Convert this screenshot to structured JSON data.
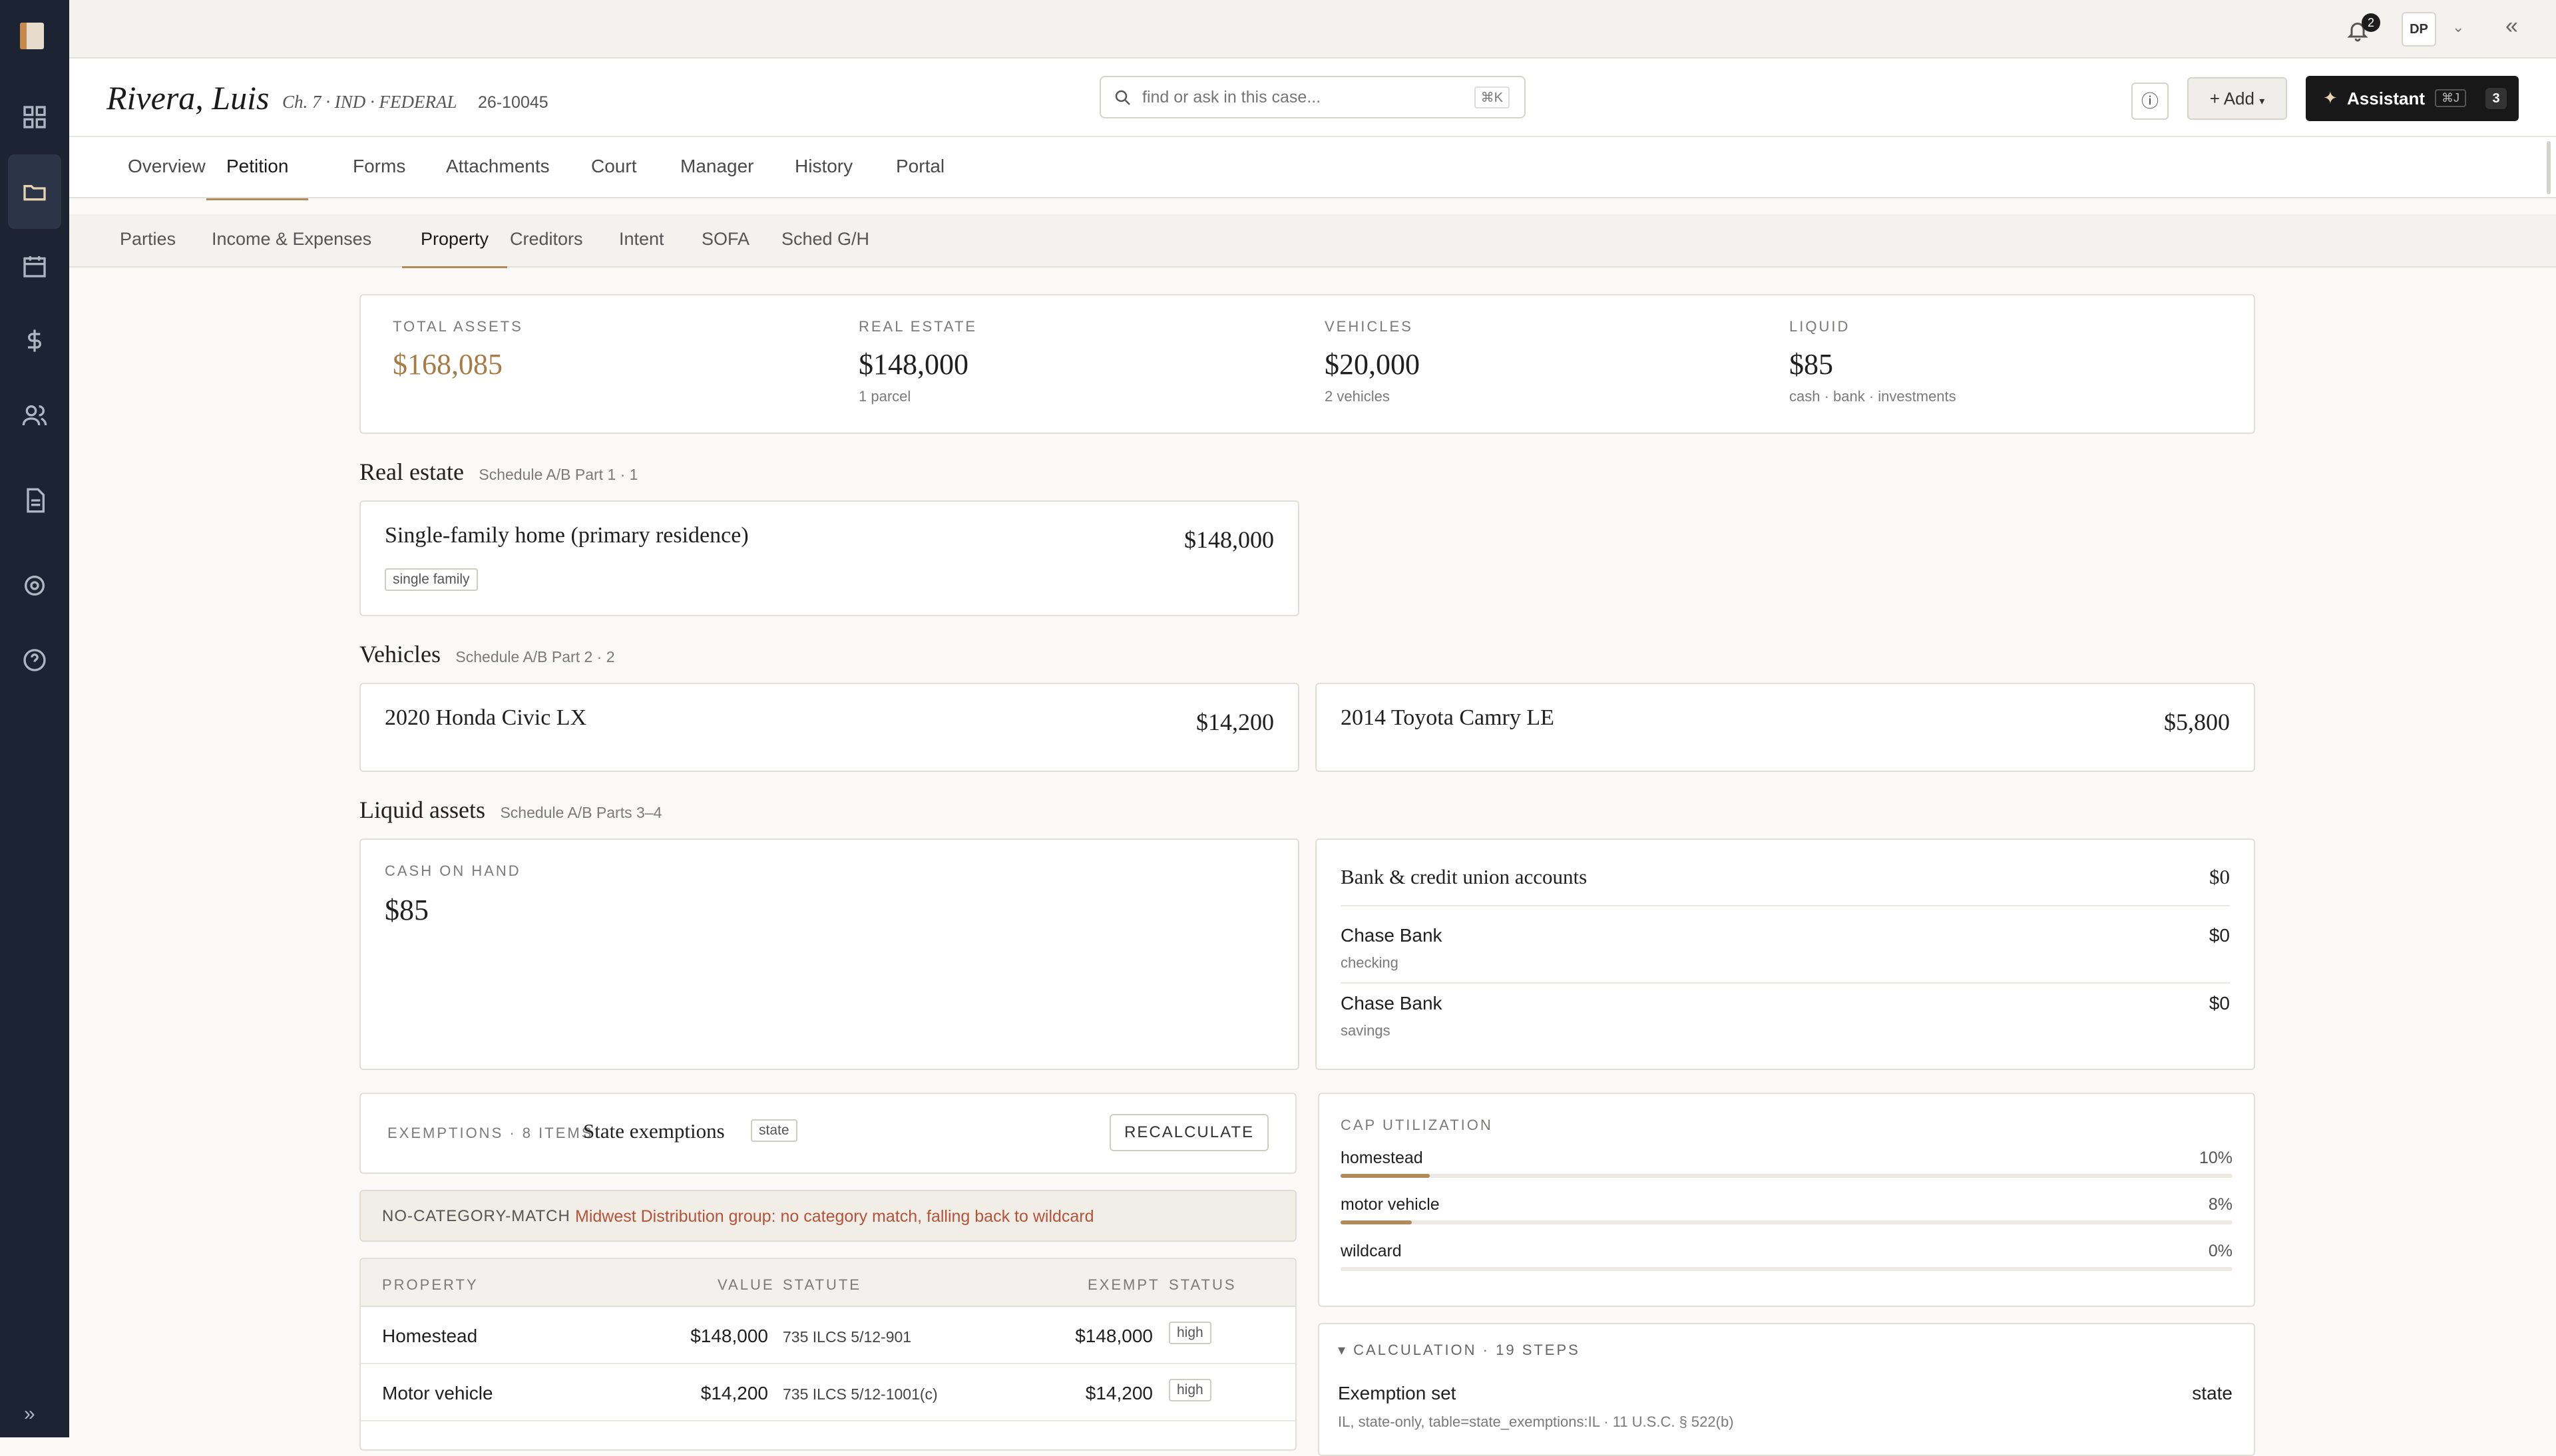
{
  "topbar": {
    "notif_count": "2",
    "user_initials": "DP"
  },
  "header": {
    "client_name": "Rivera, Luis",
    "case_meta": "Ch. 7 · IND · FEDERAL",
    "case_number": "26-10045",
    "search_placeholder": "find or ask in this case...",
    "search_shortcut": "⌘K",
    "add_label": "Add",
    "assistant_label": "Assistant",
    "assistant_shortcut": "⌘J",
    "assistant_count": "3"
  },
  "tabs": [
    "Overview",
    "Petition",
    "Forms",
    "Attachments",
    "Court",
    "Manager",
    "History",
    "Portal"
  ],
  "subtabs": [
    "Parties",
    "Income & Expenses",
    "Property",
    "Creditors",
    "Intent",
    "SOFA",
    "Sched G/H"
  ],
  "summary": [
    {
      "label": "TOTAL ASSETS",
      "value": "$168,085",
      "sub": ""
    },
    {
      "label": "REAL ESTATE",
      "value": "$148,000",
      "sub": "1 parcel"
    },
    {
      "label": "VEHICLES",
      "value": "$20,000",
      "sub": "2 vehicles"
    },
    {
      "label": "LIQUID",
      "value": "$85",
      "sub": "cash · bank · investments"
    }
  ],
  "real_estate": {
    "title": "Real estate",
    "sub": "Schedule A/B Part 1 · 1",
    "item": {
      "name": "Single-family home (primary residence)",
      "value": "$148,000",
      "tag": "single family"
    }
  },
  "vehicles": {
    "title": "Vehicles",
    "sub": "Schedule A/B Part 2 · 2",
    "items": [
      {
        "name": "2020 Honda Civic LX",
        "value": "$14,200"
      },
      {
        "name": "2014 Toyota Camry LE",
        "value": "$5,800"
      }
    ]
  },
  "liquid": {
    "title": "Liquid assets",
    "sub": "Schedule A/B Parts 3–4",
    "cash_label": "CASH ON HAND",
    "cash_value": "$85",
    "bank_title": "Bank & credit union accounts",
    "bank_total": "$0",
    "accounts": [
      {
        "name": "Chase Bank",
        "type": "checking",
        "value": "$0"
      },
      {
        "name": "Chase Bank",
        "type": "savings",
        "value": "$0"
      }
    ]
  },
  "exemptions": {
    "label": "EXEMPTIONS · 8 ITEMS",
    "title": "State exemptions",
    "tag": "state",
    "recalc": "RECALCULATE",
    "warn_code": "NO-CATEGORY-MATCH",
    "warn_text": "Midwest Distribution group: no category match, falling back to wildcard",
    "columns": [
      "PROPERTY",
      "VALUE",
      "STATUTE",
      "EXEMPT",
      "STATUS"
    ],
    "rows": [
      {
        "property": "Homestead",
        "value": "$148,000",
        "statute": "735 ILCS 5/12-901",
        "exempt": "$148,000",
        "status": "high"
      },
      {
        "property": "Motor vehicle",
        "value": "$14,200",
        "statute": "735 ILCS 5/12-1001(c)",
        "exempt": "$14,200",
        "status": "high"
      }
    ]
  },
  "cap": {
    "label": "CAP UTILIZATION",
    "items": [
      {
        "name": "homestead",
        "pct": "10%",
        "frac": 0.1
      },
      {
        "name": "motor vehicle",
        "pct": "8%",
        "frac": 0.08
      },
      {
        "name": "wildcard",
        "pct": "0%",
        "frac": 0.0
      }
    ]
  },
  "calc": {
    "label": "▾ CALCULATION · 19 STEPS",
    "step_title": "Exemption set",
    "step_value": "state",
    "step_detail": "IL, state-only, table=state_exemptions:IL · 11 U.S.C. § 522(b)"
  },
  "colors": {
    "accent": "#b08b5a",
    "danger": "#b4533a",
    "rail": "#1c2433"
  }
}
